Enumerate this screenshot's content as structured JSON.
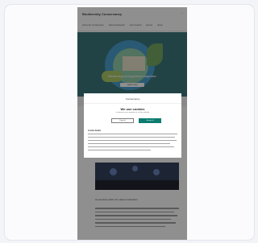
{
  "site": {
    "title": "Biodiversity Conservancy",
    "nav": [
      "About the Conservancy",
      "Data & Research",
      "Get Involved",
      "Events",
      "News"
    ],
    "hero_title": "Restoring ecosystems together",
    "hero_button": "Learn more",
    "article_title": "Community action for nature restoration"
  },
  "modal": {
    "brand": "Conservancy",
    "title": "We use cookies",
    "subtitle": "to improve your experience on this website",
    "deny_button": "Deny all",
    "accept_button": "Accept all",
    "details_heading": "Cookie details"
  },
  "colors": {
    "accent": "#0d7c70",
    "hero": "#2d6e73",
    "overlay": "rgba(20,20,20,0.48)"
  }
}
